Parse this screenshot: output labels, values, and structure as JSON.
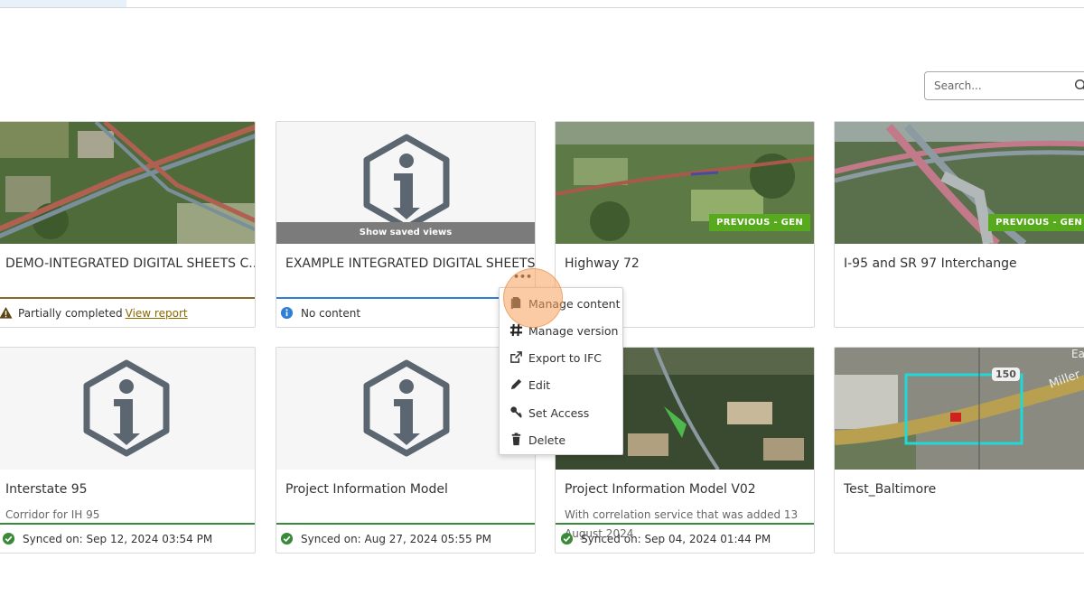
{
  "search": {
    "placeholder": "Search..."
  },
  "cards": [
    {
      "title": "DEMO-INTEGRATED DIGITAL SHEETS C...",
      "status_text": "Partially completed",
      "status_link": "View report",
      "status_type": "partial"
    },
    {
      "title": "EXAMPLE INTEGRATED DIGITAL SHEETS",
      "overlay": "Show saved views",
      "status_text": "No content",
      "status_type": "info"
    },
    {
      "title": "Highway 72",
      "badge": "PREVIOUS - GEN"
    },
    {
      "title": "I-95 and SR 97 Interchange",
      "badge": "PREVIOUS - GEN"
    },
    {
      "title": "Interstate 95",
      "description": "Corridor for IH 95",
      "status_text": "Synced on:  Sep 12, 2024 03:54 PM",
      "status_type": "synced"
    },
    {
      "title": "Project Information Model",
      "status_text": "Synced on:  Aug 27, 2024 05:55 PM",
      "status_type": "synced"
    },
    {
      "title": "Project Information Model V02",
      "description": "With correlation service that was added 13 August 2024",
      "status_text": "Synced on:  Sep 04, 2024 01:44 PM",
      "status_type": "synced"
    },
    {
      "title": "Test_Baltimore",
      "map_labels": [
        "150",
        "Miller",
        "Ea"
      ]
    }
  ],
  "context_menu": {
    "items": [
      {
        "label": "Manage content",
        "icon": "document-icon"
      },
      {
        "label": "Manage version",
        "icon": "hash-icon"
      },
      {
        "label": "Export to IFC",
        "icon": "export-icon"
      },
      {
        "label": "Edit",
        "icon": "pencil-icon"
      },
      {
        "label": "Set Access",
        "icon": "key-icon"
      },
      {
        "label": "Delete",
        "icon": "trash-icon"
      }
    ]
  },
  "colors": {
    "synced": "#3a8a3a",
    "info": "#2f7fd6",
    "partial": "#8a6a2a",
    "badge": "#56aa1c",
    "highlight": "#f5a05a"
  }
}
